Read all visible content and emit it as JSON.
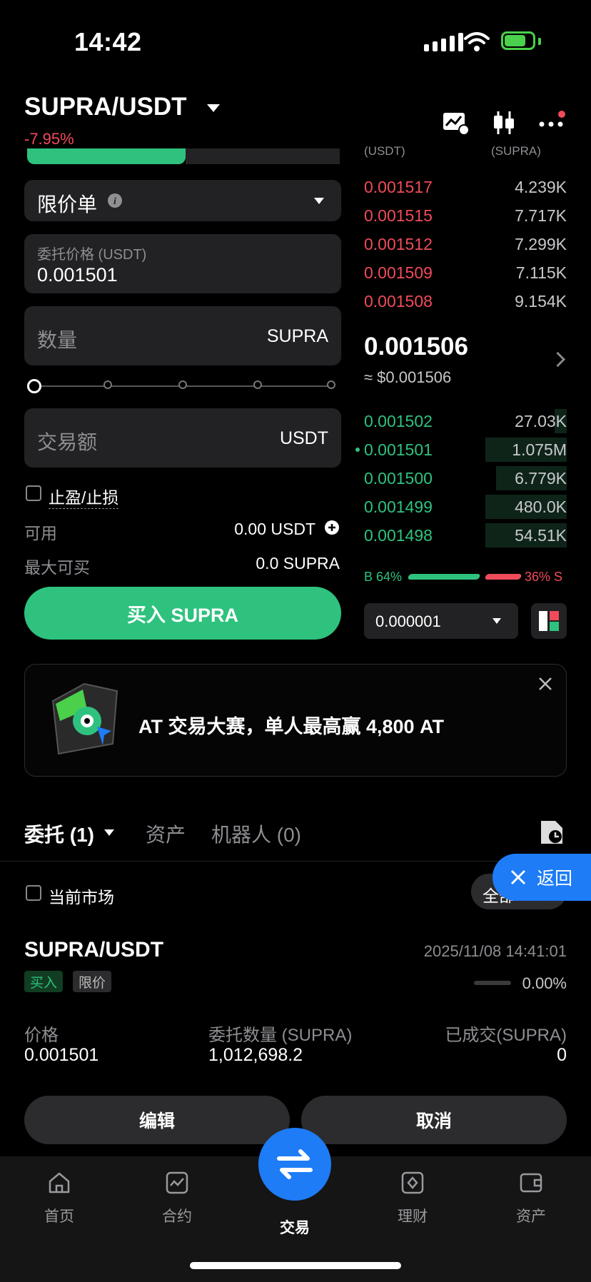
{
  "status_bar": {
    "time": "14:42"
  },
  "header": {
    "pair": "SUPRA/USDT",
    "change": "-7.95%",
    "icons": [
      "chart-icon",
      "candlestick-icon",
      "more-icon"
    ]
  },
  "order_form": {
    "order_type": "限价单",
    "price_label": "委托价格 (USDT)",
    "price_value": "0.001501",
    "amount_label": "数量",
    "amount_unit": "SUPRA",
    "total_label": "交易额",
    "total_unit": "USDT",
    "tpsl_label": "止盈/止损",
    "available_label": "可用",
    "available_value": "0.00 USDT",
    "max_buy_label": "最大可买",
    "max_buy_value": "0.0 SUPRA",
    "buy_button": "买入 SUPRA"
  },
  "order_book": {
    "price_header": "(USDT)",
    "qty_header": "(SUPRA)",
    "asks": [
      {
        "price": "0.001517",
        "qty": "4.239K"
      },
      {
        "price": "0.001515",
        "qty": "7.717K"
      },
      {
        "price": "0.001512",
        "qty": "7.299K"
      },
      {
        "price": "0.001509",
        "qty": "7.115K"
      },
      {
        "price": "0.001508",
        "qty": "9.154K"
      }
    ],
    "last_price": "0.001506",
    "last_price_usd": "≈ $0.001506",
    "bids": [
      {
        "price": "0.001502",
        "qty": "27.03K",
        "depth": 0.06
      },
      {
        "price": "0.001501",
        "qty": "1.075M",
        "depth": 0.4
      },
      {
        "price": "0.001500",
        "qty": "6.779K",
        "depth": 0.35
      },
      {
        "price": "0.001499",
        "qty": "480.0K",
        "depth": 0.4
      },
      {
        "price": "0.001498",
        "qty": "54.51K",
        "depth": 0.4
      }
    ],
    "buy_ratio": "B 64%",
    "sell_ratio": "36% S",
    "precision": "0.000001"
  },
  "banner": {
    "text": "AT 交易大赛，单人最高赢 4,800 AT"
  },
  "orders_tabs": {
    "orders": "委托 (1)",
    "assets": "资产",
    "bots": "机器人 (0)",
    "current_market": "当前市场",
    "all_pill": "全部",
    "back": "返回"
  },
  "order": {
    "pair": "SUPRA/USDT",
    "time": "2025/11/08 14:41:01",
    "side": "买入",
    "type": "限价",
    "fill_pct": "0.00%",
    "price_label": "价格",
    "price": "0.001501",
    "amount_label": "委托数量 (SUPRA)",
    "amount": "1,012,698.2",
    "filled_label": "已成交(SUPRA)",
    "filled": "0",
    "edit": "编辑",
    "cancel": "取消"
  },
  "nav": {
    "home": "首页",
    "futures": "合约",
    "trade": "交易",
    "earn": "理财",
    "assets": "资产"
  },
  "colors": {
    "green": "#2ec27e",
    "red": "#f04b5a",
    "blue": "#1e7cf7"
  }
}
